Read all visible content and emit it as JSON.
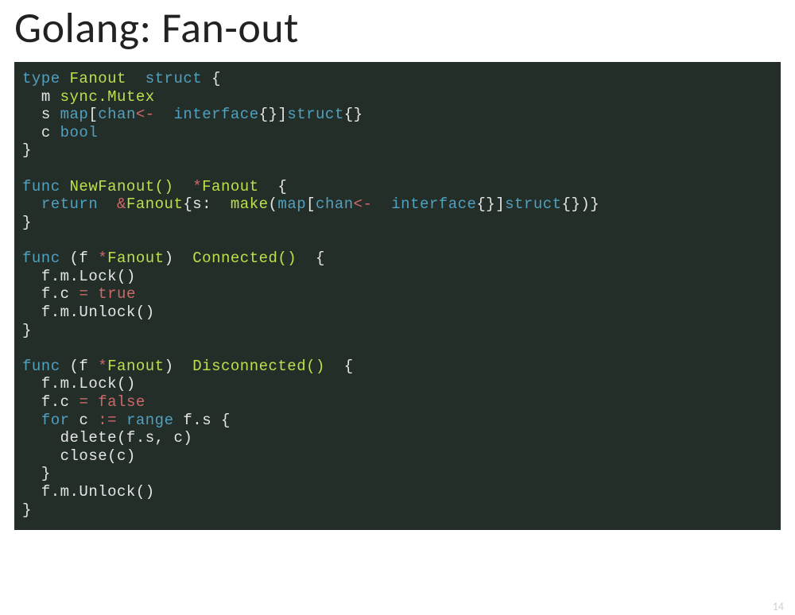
{
  "slide": {
    "title": "Golang: Fan-out",
    "page_number": "14",
    "code": {
      "l1": {
        "a": "type",
        "b": "Fanout",
        "c": "struct",
        "d": "{"
      },
      "l2": {
        "a": "m",
        "b": "sync.Mutex"
      },
      "l3": {
        "a": "s",
        "b": "map",
        "c": "[",
        "d": "chan",
        "e": "<-",
        "f": "interface",
        "g": "{}]",
        "h": "struct",
        "i": "{}"
      },
      "l4": {
        "a": "c",
        "b": "bool"
      },
      "l5": {
        "a": "}"
      },
      "l6": {
        "a": "func",
        "b": "NewFanout()",
        "c": "*",
        "d": "Fanout",
        "e": "{"
      },
      "l7": {
        "a": "return",
        "b": "&",
        "c": "Fanout",
        "d": "{s:",
        "e": "make",
        "f": "(",
        "g": "map",
        "h": "[",
        "i": "chan",
        "j": "<-",
        "k": "interface",
        "l": "{}]",
        "m": "struct",
        "n": "{})}"
      },
      "l8": {
        "a": "}"
      },
      "l9": {
        "a": "func",
        "b": "(f",
        "c": "*",
        "d": "Fanout",
        "e": ")",
        "f": "Connected()",
        "g": "{"
      },
      "l10": {
        "a": "f.m.Lock()"
      },
      "l11": {
        "a": "f.c",
        "b": "=",
        "c": "true"
      },
      "l12": {
        "a": "f.m.Unlock()"
      },
      "l13": {
        "a": "}"
      },
      "l14": {
        "a": "func",
        "b": "(f",
        "c": "*",
        "d": "Fanout",
        "e": ")",
        "f": "Disconnected()",
        "g": "{"
      },
      "l15": {
        "a": "f.m.Lock()"
      },
      "l16": {
        "a": "f.c",
        "b": "=",
        "c": "false"
      },
      "l17": {
        "a": "for",
        "b": "c",
        "c": ":=",
        "d": "range",
        "e": "f.s",
        "f": "{"
      },
      "l18": {
        "a": "delete(f.s,",
        "b": "c)"
      },
      "l19": {
        "a": "close(c)"
      },
      "l20": {
        "a": "}"
      },
      "l21": {
        "a": "f.m.Unlock()"
      },
      "l22": {
        "a": "}"
      }
    }
  }
}
